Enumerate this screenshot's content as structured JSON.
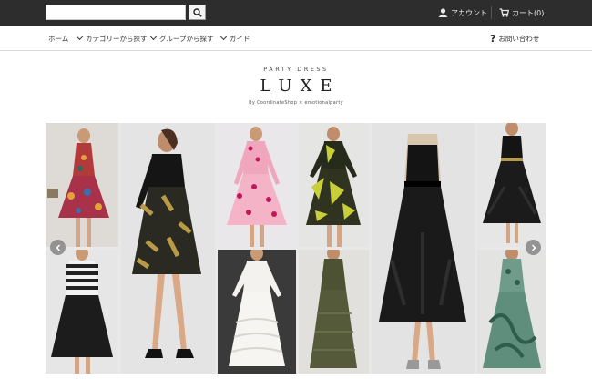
{
  "topbar": {
    "search_placeholder": "",
    "account_label": "アカウント",
    "cart_label": "カート(0)"
  },
  "nav": {
    "home": "ホーム",
    "category": "カテゴリーから探す",
    "group": "グループから探す",
    "guide": "ガイド",
    "contact": "お問い合わせ"
  },
  "brand": {
    "subtitle": "PARTY DRESS",
    "title": "LUXE",
    "byline": "By CoordinateShop × emotionalparty"
  },
  "colors": {
    "topbar_bg": "#2d2d2d",
    "accent_text": "#222222"
  },
  "gallery": {
    "icons": [
      "chevron-left-icon",
      "chevron-right-icon"
    ]
  }
}
